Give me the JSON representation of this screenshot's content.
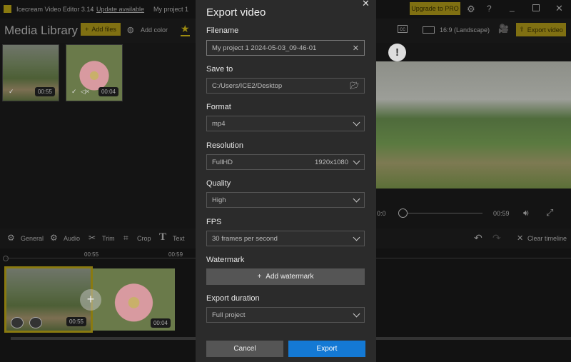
{
  "titlebar": {
    "app": "Icecream Video Editor 3.14",
    "sep": "-",
    "update": "Update available",
    "project": "My project 1",
    "upgrade": "Upgrade to PRO"
  },
  "toolbar": {
    "title": "Media Library",
    "add_files": "Add files",
    "add_color": "Add color",
    "aspect": "16:9 (Landscape)",
    "export": "Export video"
  },
  "library": [
    {
      "duration": "00:55"
    },
    {
      "duration": "00:04"
    }
  ],
  "player": {
    "current": "0:0",
    "total": "00:59",
    "progress": 0
  },
  "tools": {
    "general": "General",
    "audio": "Audio",
    "trim": "Trim",
    "crop": "Crop",
    "text": "Text",
    "clear": "Clear timeline"
  },
  "timeline": {
    "ticks": [
      "00:55",
      "00:59"
    ],
    "clips": [
      {
        "duration": "00:55"
      },
      {
        "duration": "00:04"
      }
    ]
  },
  "dialog": {
    "title": "Export video",
    "filename_label": "Filename",
    "filename": "My project 1 2024-05-03_09-46-01",
    "saveto_label": "Save to",
    "saveto": "C:/Users/ICE2/Desktop",
    "format_label": "Format",
    "format": "mp4",
    "resolution_label": "Resolution",
    "resolution": "FullHD",
    "resolution_size": "1920x1080",
    "quality_label": "Quality",
    "quality": "High",
    "fps_label": "FPS",
    "fps": "30 frames per second",
    "watermark_label": "Watermark",
    "add_watermark": "Add watermark",
    "duration_label": "Export duration",
    "duration": "Full project",
    "cancel": "Cancel",
    "export": "Export"
  }
}
